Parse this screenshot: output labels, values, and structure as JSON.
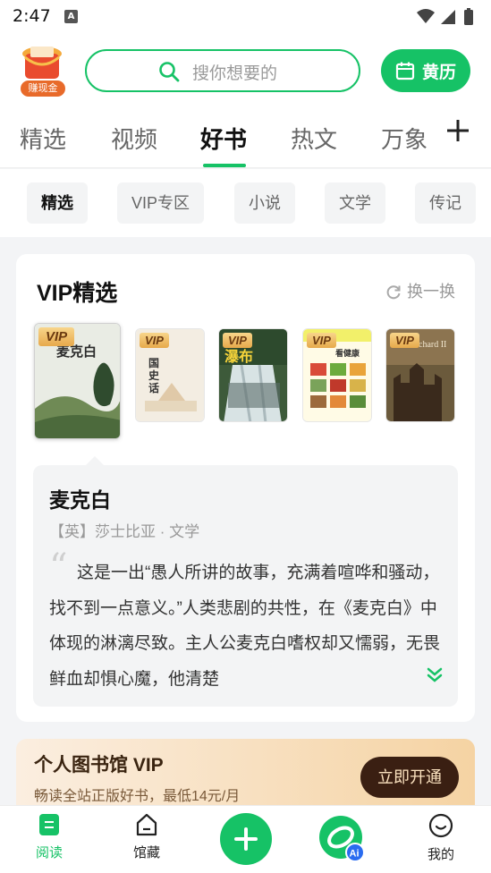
{
  "status_bar": {
    "time": "2:47",
    "notification_letter": "A"
  },
  "header": {
    "coin_badge": "赚现金",
    "search_placeholder": "搜你想要的",
    "almanac_label": "黄历"
  },
  "tabs": [
    "精选",
    "视频",
    "好书",
    "热文",
    "万象"
  ],
  "active_tab": "好书",
  "chips": [
    "精选",
    "VIP专区",
    "小说",
    "文学",
    "传记"
  ],
  "active_chip": "精选",
  "vip_section": {
    "title": "VIP精选",
    "refresh_label": "换一换",
    "covers": [
      {
        "badge": "VIP",
        "cover_text": "麦克白",
        "icon": "macbeth-cover"
      },
      {
        "badge": "VIP",
        "cover_text": "国史话",
        "icon": "history-cover"
      },
      {
        "badge": "VIP",
        "cover_text": "瀑布",
        "icon": "waterfall-cover"
      },
      {
        "badge": "VIP",
        "cover_text": "吃出健康",
        "icon": "food-cover"
      },
      {
        "badge": "VIP",
        "cover_text": "chard II",
        "icon": "castle-cover"
      }
    ],
    "selected_book": {
      "title": "麦克白",
      "meta": "【英】莎士比亚 · 文学",
      "description": "这是一出“愚人所讲的故事，充满着喧哗和骚动，找不到一点意义。”人类悲剧的共性，在《麦克白》中体现的淋漓尽致。主人公麦克白嗜权却又懦弱，无畏鲜血却惧心魔，他清楚"
    }
  },
  "vip_banner": {
    "title": "个人图书馆 VIP",
    "subtitle": "畅读全站正版好书，最低14元/月",
    "button": "立即开通"
  },
  "bottom_nav": {
    "read": "阅读",
    "collection": "馆藏",
    "ai_badge": "Ai",
    "mine": "我的"
  },
  "colors": {
    "accent": "#16c266",
    "vip_gold": "#e7a94b",
    "vip_dark": "#3a1f12"
  }
}
